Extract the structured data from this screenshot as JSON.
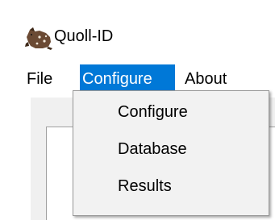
{
  "window": {
    "title": "Quoll-ID",
    "icon": "quoll-icon"
  },
  "menu_bar": {
    "items": [
      {
        "label": "File",
        "active": false
      },
      {
        "label": "Configure",
        "active": true
      },
      {
        "label": "About",
        "active": false
      }
    ]
  },
  "dropdown": {
    "items": [
      {
        "label": "Configure"
      },
      {
        "label": "Database"
      },
      {
        "label": "Results"
      }
    ]
  },
  "colors": {
    "accent": "#0078d7",
    "menu_background": "#f2f2f2",
    "window_background": "#ffffff",
    "content_background": "#f0f0f0"
  }
}
